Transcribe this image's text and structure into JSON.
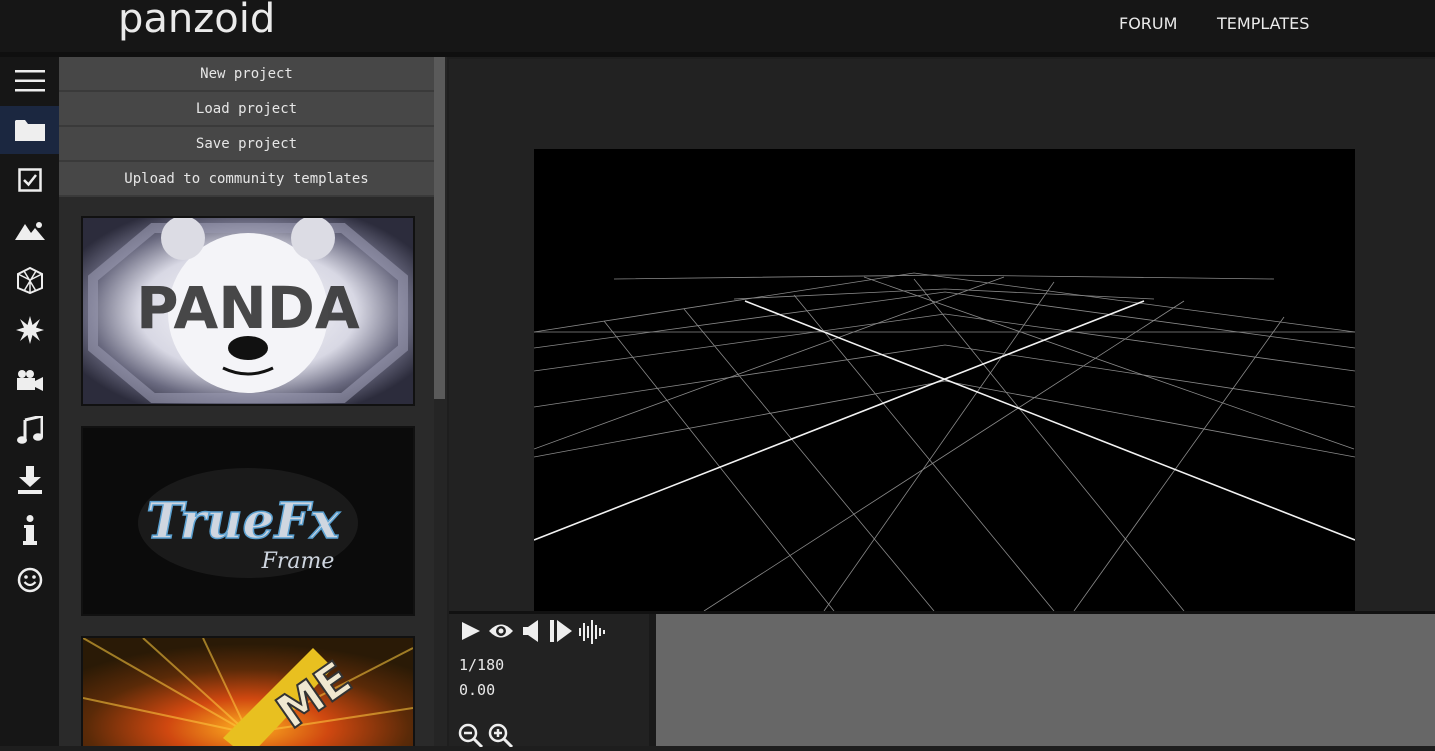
{
  "app": {
    "logo_text": "panzoid"
  },
  "topnav": {
    "forum": "FORUM",
    "templates": "TEMPLATES"
  },
  "rail": {
    "items": [
      {
        "icon": "hamburger-menu-icon"
      },
      {
        "icon": "folder-icon",
        "active": true
      },
      {
        "icon": "checkbox-icon"
      },
      {
        "icon": "image-icon"
      },
      {
        "icon": "cube-icon"
      },
      {
        "icon": "burst-icon"
      },
      {
        "icon": "video-camera-icon"
      },
      {
        "icon": "music-note-icon"
      },
      {
        "icon": "download-icon"
      },
      {
        "icon": "info-icon"
      },
      {
        "icon": "smiley-icon"
      }
    ]
  },
  "project_menu": {
    "new": "New project",
    "load": "Load project",
    "save": "Save project",
    "upload": "Upload to community templates"
  },
  "templates": [
    {
      "text": "PANDA"
    },
    {
      "text": "TrueFx",
      "subtext": "Frame"
    },
    {
      "text": "ME"
    }
  ],
  "timeline": {
    "frame": "1/180",
    "time": "0.00"
  },
  "colors": {
    "topbar": "#161616",
    "panel_button": "#474747",
    "active_rail": "#1b2740",
    "canvas": "#000000",
    "timeline_track": "#676767"
  }
}
